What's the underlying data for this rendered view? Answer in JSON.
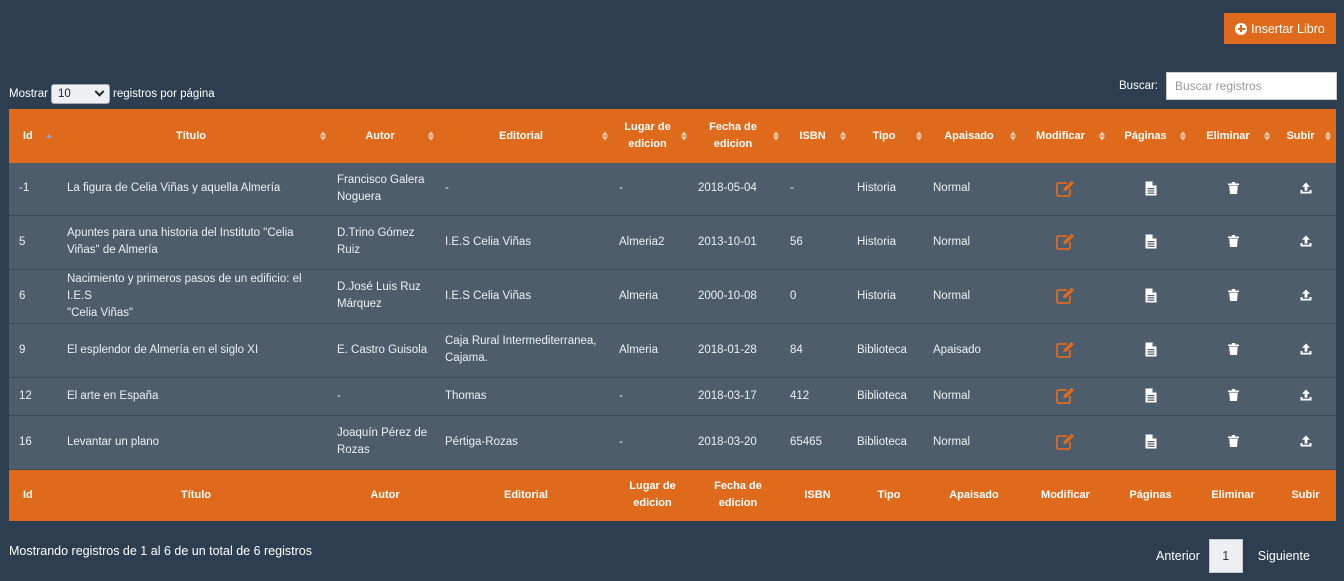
{
  "toolbar": {
    "insert_label": "Insertar Libro"
  },
  "length": {
    "prefix": "Mostrar",
    "value": "10",
    "suffix": "registros por página"
  },
  "search": {
    "label": "Buscar:",
    "placeholder": "Buscar registros"
  },
  "columns": [
    "Id",
    "Título",
    "Autor",
    "Editorial",
    "Lugar de edicion",
    "Fecha de edicion",
    "ISBN",
    "Tipo",
    "Apaisado",
    "Modificar",
    "Páginas",
    "Eliminar",
    "Subir"
  ],
  "header_cells": {
    "lugar": [
      "Lugar de",
      "edicion"
    ],
    "fecha": [
      "Fecha de",
      "edicion"
    ]
  },
  "rows": [
    {
      "id": "-1",
      "titulo": [
        "La figura de Celia Viñas y aquella Almería"
      ],
      "autor": [
        "Francisco Galera",
        "Noguera"
      ],
      "editorial": [
        "-"
      ],
      "lugar": "-",
      "fecha": "2018-05-04",
      "isbn": "-",
      "tipo": "Historia",
      "apaisado": "Normal"
    },
    {
      "id": "5",
      "titulo": [
        "Apuntes para una historia del Instituto \"Celia",
        "Viñas\" de Almería"
      ],
      "autor": [
        "D.Trino Gómez",
        "Ruiz"
      ],
      "editorial": [
        "I.E.S Celia Viñas"
      ],
      "lugar": "Almeria2",
      "fecha": "2013-10-01",
      "isbn": "56",
      "tipo": "Historia",
      "apaisado": "Normal"
    },
    {
      "id": "6",
      "titulo": [
        "Nacimiento y primeros pasos de un edificio: el I.E.S",
        "\"Celia Viñas\""
      ],
      "autor": [
        "D.José Luis Ruz",
        "Márquez"
      ],
      "editorial": [
        "I.E.S Celia Viñas"
      ],
      "lugar": "Almeria",
      "fecha": "2000-10-08",
      "isbn": "0",
      "tipo": "Historia",
      "apaisado": "Normal"
    },
    {
      "id": "9",
      "titulo": [
        "El esplendor de Almería en el siglo XI"
      ],
      "autor": [
        "E. Castro Guisola"
      ],
      "editorial": [
        "Caja Rural Intermediterranea,",
        "Cajama."
      ],
      "lugar": "Almeria",
      "fecha": "2018-01-28",
      "isbn": "84",
      "tipo": "Biblioteca",
      "apaisado": "Apaisado"
    },
    {
      "id": "12",
      "titulo": [
        "El arte en España"
      ],
      "autor": [
        "-"
      ],
      "editorial": [
        "Thomas"
      ],
      "lugar": "-",
      "fecha": "2018-03-17",
      "isbn": "412",
      "tipo": "Biblioteca",
      "apaisado": "Normal"
    },
    {
      "id": "16",
      "titulo": [
        "Levantar un plano"
      ],
      "autor": [
        "Joaquín Pérez de",
        "Rozas"
      ],
      "editorial": [
        "Pértiga-Rozas"
      ],
      "lugar": "-",
      "fecha": "2018-03-20",
      "isbn": "65465",
      "tipo": "Biblioteca",
      "apaisado": "Normal"
    }
  ],
  "footer": {
    "info": "Mostrando registros de 1 al 6 de un total de 6 registros",
    "prev": "Anterior",
    "page": "1",
    "next": "Siguiente"
  },
  "colors": {
    "accent": "#e06a1b",
    "background": "#2c3e50",
    "row": "#4e5d6c",
    "sort_active": "#8fa4d8"
  },
  "icons": {
    "modificar": "edit-icon",
    "paginas": "file-icon",
    "eliminar": "trash-icon",
    "subir": "upload-icon"
  }
}
